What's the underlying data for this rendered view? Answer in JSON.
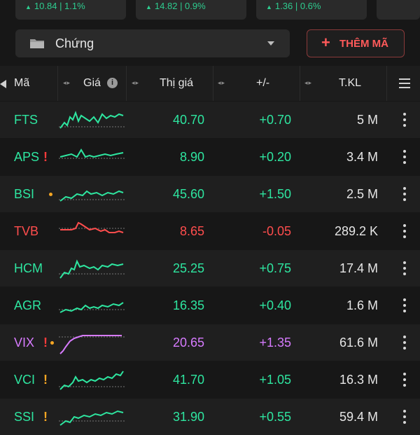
{
  "index_strip": [
    {
      "text": "10.84 | 1.1%"
    },
    {
      "text": "14.82 | 0.9%"
    },
    {
      "text": "1.36 | 0.6%"
    }
  ],
  "toolbar": {
    "select_label": "Chứng",
    "add_label": "THÊM MÃ"
  },
  "columns": {
    "symbol": "Mã",
    "price": "Giá",
    "market_price": "Thị giá",
    "change": "+/-",
    "volume": "T.KL"
  },
  "colors": {
    "up": "#2ee6a0",
    "down": "#ff4d4d",
    "ceiling": "#d77bff",
    "alert_red": "#ff3b3b",
    "alert_orange": "#f5a623"
  },
  "rows": [
    {
      "symbol": "FTS",
      "alert": "",
      "dot": false,
      "price": "40.70",
      "change": "+0.70",
      "volume": "5 M",
      "color": "up"
    },
    {
      "symbol": "APS",
      "alert": "!",
      "dot": false,
      "price": "8.90",
      "change": "+0.20",
      "volume": "3.4 M",
      "color": "up"
    },
    {
      "symbol": "BSI",
      "alert": "",
      "dot": true,
      "price": "45.60",
      "change": "+1.50",
      "volume": "2.5 M",
      "color": "up"
    },
    {
      "symbol": "TVB",
      "alert": "",
      "dot": false,
      "price": "8.65",
      "change": "-0.05",
      "volume": "289.2 K",
      "color": "down"
    },
    {
      "symbol": "HCM",
      "alert": "",
      "dot": false,
      "price": "25.25",
      "change": "+0.75",
      "volume": "17.4 M",
      "color": "up"
    },
    {
      "symbol": "AGR",
      "alert": "",
      "dot": false,
      "price": "16.35",
      "change": "+0.40",
      "volume": "1.6 M",
      "color": "up"
    },
    {
      "symbol": "VIX",
      "alert": "!",
      "dot": true,
      "price": "20.65",
      "change": "+1.35",
      "volume": "61.6 M",
      "color": "ceiling"
    },
    {
      "symbol": "VCI",
      "alert": "!",
      "dot": false,
      "price": "41.70",
      "change": "+1.05",
      "volume": "16.3 M",
      "color": "up"
    },
    {
      "symbol": "SSI",
      "alert": "!",
      "dot": false,
      "price": "31.90",
      "change": "+0.55",
      "volume": "59.4 M",
      "color": "up"
    }
  ]
}
